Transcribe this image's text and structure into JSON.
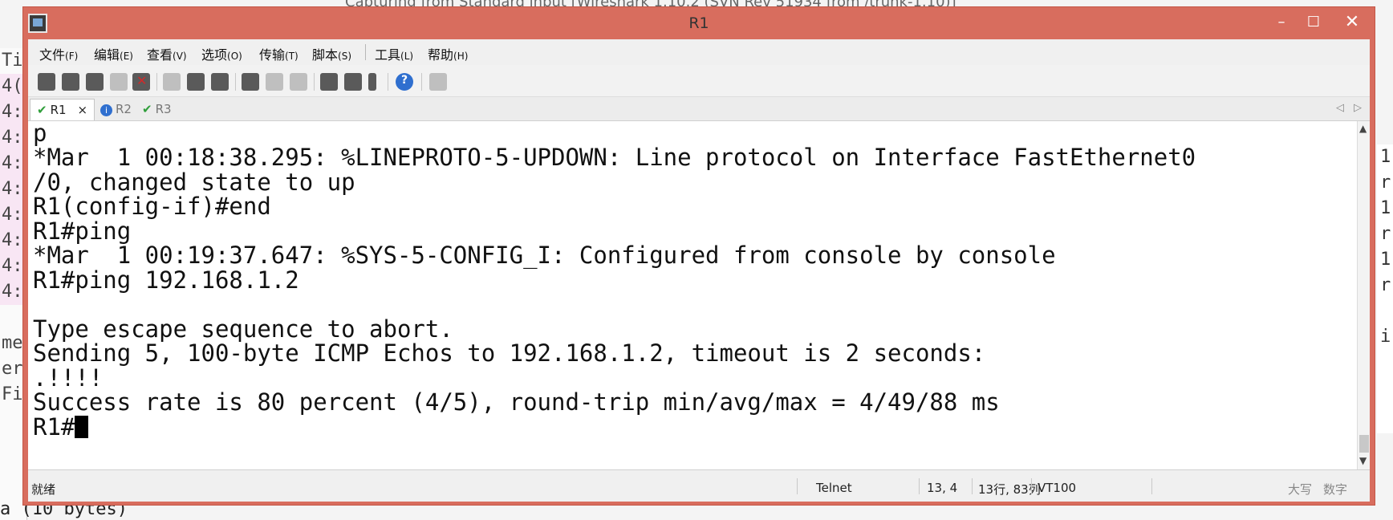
{
  "background": {
    "title": "Capturing from Standard input  [Wireshark 1.10.2 (SVN Rev 51934 from /trunk-1.10)]",
    "left_rows": [
      "Ti",
      "4(",
      "4:",
      "4:",
      "4:",
      "4:",
      "4:",
      "4:",
      "4:",
      "4:",
      "",
      "me",
      "er",
      "Fi",
      "a (10 bytes)"
    ],
    "right_rows": [
      "1",
      "r",
      "1",
      "r",
      "1",
      "r",
      "",
      "i"
    ]
  },
  "window": {
    "title": "R1",
    "min_label": "–",
    "max_label": "☐",
    "close_label": "✕",
    "accent": "#d86d5e"
  },
  "menu": {
    "items": [
      {
        "label": "文件",
        "key": "(F)"
      },
      {
        "label": "编辑",
        "key": "(E)"
      },
      {
        "label": "查看",
        "key": "(V)"
      },
      {
        "label": "选项",
        "key": "(O)"
      },
      {
        "label": "传输",
        "key": "(T)"
      },
      {
        "label": "脚本",
        "key": "(S)"
      },
      {
        "label": "工具",
        "key": "(L)"
      },
      {
        "label": "帮助",
        "key": "(H)"
      }
    ]
  },
  "toolbar": {
    "icons": [
      "connect-icon",
      "quick-connect-icon",
      "connect-tab-icon",
      "reconnect-icon",
      "disconnect-icon",
      "copy-icon",
      "paste-icon",
      "find-icon",
      "print-icon",
      "print-setup-icon",
      "print-preview-icon",
      "session-options-icon",
      "global-options-icon",
      "key-icon",
      "help-icon",
      "keymap-icon"
    ]
  },
  "tabs": [
    {
      "label": "R1",
      "state": "connected",
      "active": true,
      "close": "×"
    },
    {
      "label": "R2",
      "state": "info",
      "active": false
    },
    {
      "label": "R3",
      "state": "connected",
      "active": false
    }
  ],
  "tab_nav": {
    "prev": "◁",
    "next": "▷"
  },
  "terminal": {
    "lines": [
      "p",
      "*Mar  1 00:18:38.295: %LINEPROTO-5-UPDOWN: Line protocol on Interface FastEthernet0",
      "/0, changed state to up",
      "R1(config-if)#end",
      "R1#ping",
      "*Mar  1 00:19:37.647: %SYS-5-CONFIG_I: Configured from console by console",
      "R1#ping 192.168.1.2",
      "",
      "Type escape sequence to abort.",
      "Sending 5, 100-byte ICMP Echos to 192.168.1.2, timeout is 2 seconds:",
      ".!!!!",
      "Success rate is 80 percent (4/5), round-trip min/avg/max = 4/49/88 ms"
    ],
    "prompt": "R1#"
  },
  "scrollbar": {
    "up": "▲",
    "down": "▼"
  },
  "status": {
    "ready": "就绪",
    "protocol": "Telnet",
    "cursor_pos": "13,  4",
    "dimensions": "13行, 83列",
    "emulation": "VT100",
    "caps": "大写",
    "num": "数字"
  }
}
